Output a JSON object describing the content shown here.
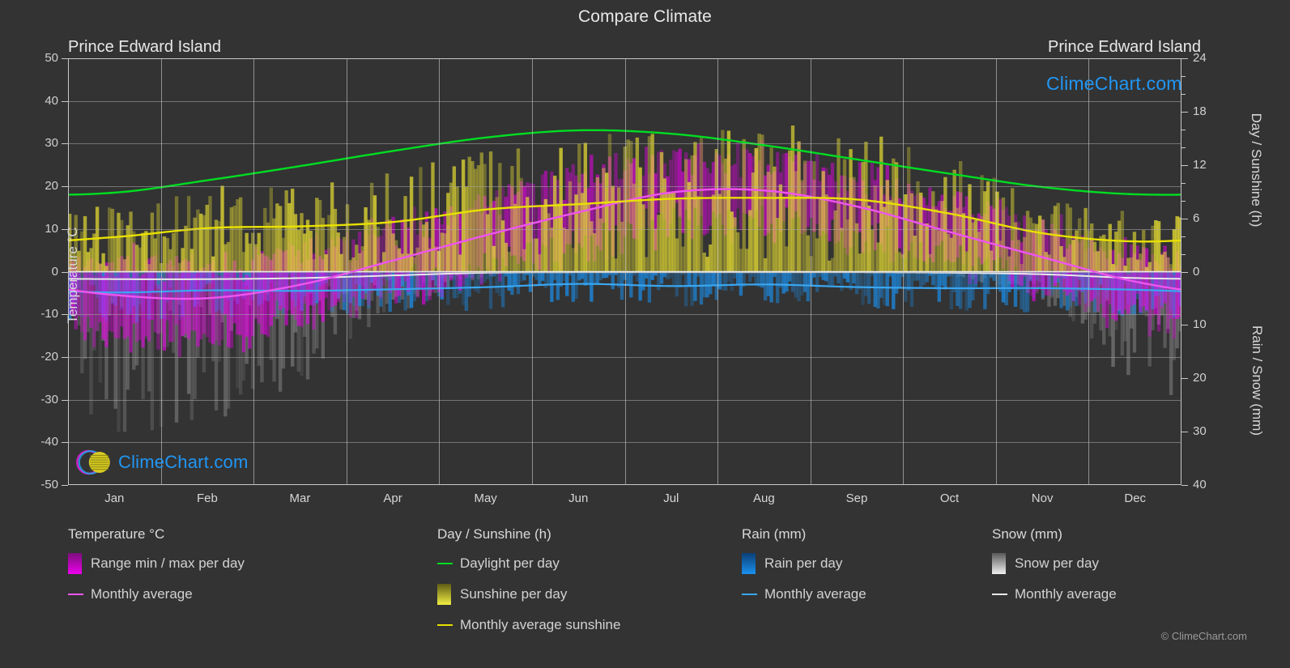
{
  "header": {
    "title": "Compare Climate",
    "location_left": "Prince Edward Island",
    "location_right": "Prince Edward Island"
  },
  "branding": {
    "logo_text": "ClimeChart.com",
    "copyright": "© ClimeChart.com",
    "logo_text_color": "#2196f3",
    "logo_arc_color": "#cc22cc",
    "logo_sphere_color": "#d6cc22"
  },
  "axes": {
    "left": {
      "title": "Temperature °C",
      "ticks": [
        50,
        40,
        30,
        20,
        10,
        0,
        -10,
        -20,
        -30,
        -40,
        -50
      ],
      "min": -50,
      "max": 50
    },
    "right_top": {
      "title": "Day / Sunshine (h)",
      "ticks": [
        24,
        18,
        12,
        6,
        0
      ],
      "min": 0,
      "max": 24
    },
    "right_bottom": {
      "title": "Rain / Snow (mm)",
      "ticks": [
        0,
        10,
        20,
        30,
        40
      ],
      "min": 0,
      "max": 40
    },
    "x": {
      "ticks": [
        "Jan",
        "Feb",
        "Mar",
        "Apr",
        "May",
        "Jun",
        "Jul",
        "Aug",
        "Sep",
        "Oct",
        "Nov",
        "Dec"
      ]
    }
  },
  "legend": {
    "groups": [
      {
        "title": "Temperature °C",
        "items": [
          {
            "label": "Range min / max per day",
            "marker": "swatch",
            "color": "#ee00ee",
            "color2": "#7a0f7a"
          },
          {
            "label": "Monthly average",
            "marker": "line",
            "color": "#ee55ee"
          }
        ]
      },
      {
        "title": "Day / Sunshine (h)",
        "items": [
          {
            "label": "Daylight per day",
            "marker": "line",
            "color": "#00dd22"
          },
          {
            "label": "Sunshine per day",
            "marker": "swatch",
            "color": "#f2ee44",
            "color2": "#5e5c14"
          },
          {
            "label": "Monthly average sunshine",
            "marker": "line",
            "color": "#e8e000"
          }
        ]
      },
      {
        "title": "Rain (mm)",
        "items": [
          {
            "label": "Rain per day",
            "marker": "swatch",
            "color": "#1a90ee",
            "color2": "#0b3f75"
          },
          {
            "label": "Monthly average",
            "marker": "line",
            "color": "#3aa6f0"
          }
        ]
      },
      {
        "title": "Snow (mm)",
        "items": [
          {
            "label": "Snow per day",
            "marker": "swatch",
            "color": "#f0f0f0",
            "color2": "#585858"
          },
          {
            "label": "Monthly average",
            "marker": "line",
            "color": "#e9e9e9"
          }
        ]
      }
    ]
  },
  "chart_data": {
    "type": "line",
    "title": "Compare Climate",
    "subtitle": "Prince Edward Island",
    "xlabel": "",
    "ylabel": "Temperature °C",
    "grid": true,
    "legend_position": "below",
    "categories": [
      "Jan",
      "Feb",
      "Mar",
      "Apr",
      "May",
      "Jun",
      "Jul",
      "Aug",
      "Sep",
      "Oct",
      "Nov",
      "Dec"
    ],
    "axis_ranges": {
      "temperature_c": [
        -50,
        50
      ],
      "day_sunshine_h": [
        0,
        24
      ],
      "rain_snow_mm": [
        0,
        40
      ]
    },
    "series": [
      {
        "name": "Daylight per day",
        "unit": "h",
        "axis": "day_sunshine_h",
        "color": "#00dd22",
        "values": [
          8.9,
          10.3,
          11.9,
          13.6,
          15.1,
          15.9,
          15.5,
          14.2,
          12.6,
          11.0,
          9.5,
          8.7
        ]
      },
      {
        "name": "Monthly average sunshine",
        "unit": "h",
        "axis": "day_sunshine_h",
        "color": "#e8e000",
        "values": [
          3.9,
          4.9,
          5.1,
          5.6,
          7.0,
          7.6,
          8.2,
          8.3,
          8.1,
          6.5,
          4.3,
          3.4
        ]
      },
      {
        "name": "Monthly average temperature",
        "unit": "°C",
        "axis": "temperature_c",
        "color": "#ee55ee",
        "values": [
          -5.5,
          -6.2,
          -3.0,
          2.7,
          8.6,
          14.0,
          18.6,
          19.0,
          15.2,
          9.2,
          3.3,
          -2.4
        ]
      },
      {
        "name": "Rain monthly average",
        "unit": "mm",
        "axis": "rain_snow_mm",
        "color": "#3aa6f0",
        "values": [
          3.9,
          3.5,
          3.6,
          3.3,
          2.9,
          2.3,
          2.7,
          2.4,
          2.9,
          3.1,
          3.1,
          3.4
        ]
      },
      {
        "name": "Snow monthly average",
        "unit": "mm",
        "axis": "rain_snow_mm",
        "color": "#e9e9e9",
        "values": [
          1.4,
          1.4,
          1.2,
          0.7,
          0.2,
          0.1,
          0.1,
          0.1,
          0.1,
          0.2,
          0.5,
          1.2
        ]
      }
    ],
    "bands": [
      {
        "name": "Range min / max per day",
        "unit": "°C",
        "axis": "temperature_c",
        "color": "#ee00ee",
        "min": [
          -12,
          -13,
          -8,
          -2,
          3,
          9,
          13,
          14,
          10,
          5,
          -1,
          -7
        ],
        "max": [
          0,
          -1,
          3,
          8,
          15,
          20,
          24,
          24,
          20,
          14,
          8,
          2
        ]
      },
      {
        "name": "Sunshine per day",
        "unit": "h",
        "axis": "day_sunshine_h",
        "color": "#d6cc22",
        "values": [
          3.9,
          4.9,
          5.1,
          5.6,
          7.0,
          7.6,
          8.2,
          8.3,
          8.1,
          6.5,
          4.3,
          3.4
        ]
      },
      {
        "name": "Rain per day",
        "unit": "mm",
        "axis": "rain_snow_mm",
        "color": "#1a90ee",
        "values": [
          3.9,
          3.5,
          3.6,
          3.3,
          2.9,
          2.3,
          2.7,
          2.4,
          2.9,
          3.1,
          3.1,
          3.4
        ]
      },
      {
        "name": "Snow per day",
        "unit": "mm",
        "axis": "rain_snow_mm",
        "color": "#cfcfcf",
        "values": [
          14,
          13,
          10,
          4,
          0.5,
          0,
          0,
          0,
          0,
          0.5,
          3,
          10
        ]
      }
    ]
  }
}
